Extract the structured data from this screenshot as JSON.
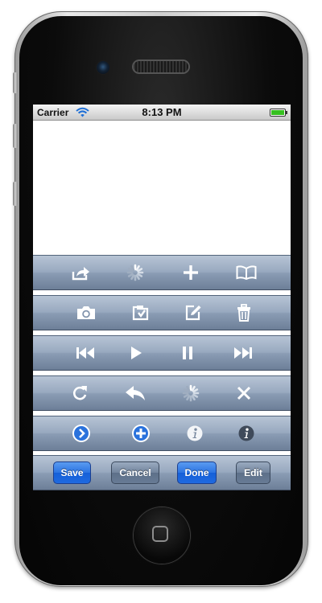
{
  "status_bar": {
    "carrier": "Carrier",
    "time": "8:13 PM"
  },
  "toolbars": [
    {
      "items": [
        "share-icon",
        "activity-spinner-icon",
        "add-icon",
        "bookmarks-icon"
      ]
    },
    {
      "items": [
        "camera-icon",
        "organize-icon",
        "compose-icon",
        "trash-icon"
      ]
    },
    {
      "items": [
        "rewind-icon",
        "play-icon",
        "pause-icon",
        "fast-forward-icon"
      ]
    },
    {
      "items": [
        "refresh-icon",
        "reply-icon",
        "activity-spinner-icon",
        "stop-icon"
      ]
    },
    {
      "items": [
        "detail-disclosure-icon",
        "contact-add-icon",
        "info-light-icon",
        "info-dark-icon"
      ]
    }
  ],
  "buttons_bar": {
    "save": "Save",
    "cancel": "Cancel",
    "done": "Done",
    "edit": "Edit"
  },
  "colors": {
    "toolbar_top": "#b7c4d5",
    "toolbar_bottom": "#6d7f98",
    "done_blue": "#2b73e2",
    "battery_green": "#36c020"
  }
}
